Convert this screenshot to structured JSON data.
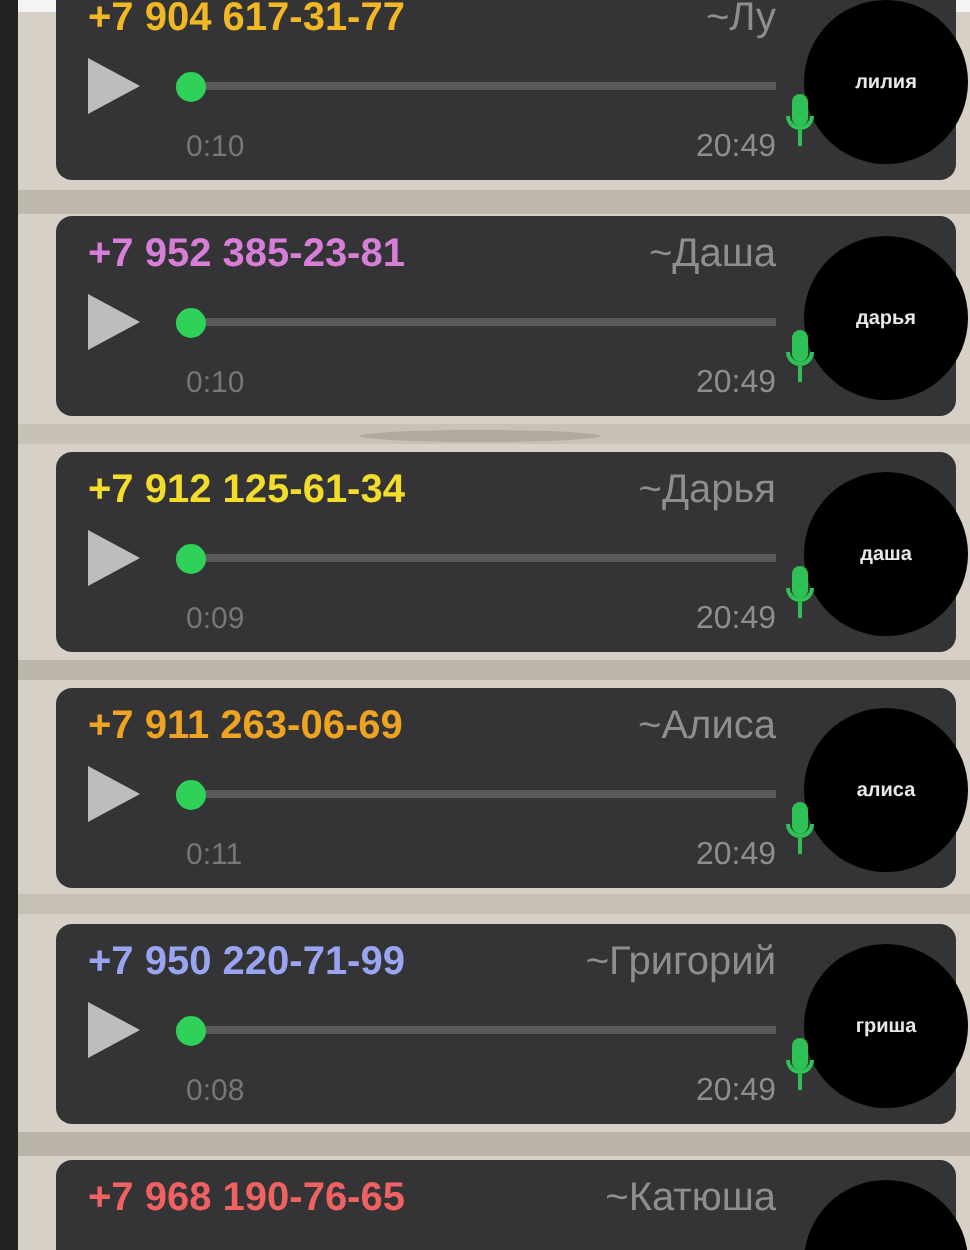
{
  "messages": [
    {
      "phone": "+7 904 617-31-77",
      "color": "#f2b824",
      "name": "~Лу",
      "duration": "0:10",
      "time": "20:49",
      "level": 0,
      "avatar_label": "лилия"
    },
    {
      "phone": "+7 952 385-23-81",
      "color": "#d77ed8",
      "name": "~Даша",
      "duration": "0:10",
      "time": "20:49",
      "level": 0,
      "avatar_label": "дарья"
    },
    {
      "phone": "+7 912 125-61-34",
      "color": "#f3dc2a",
      "name": "~Дарья",
      "duration": "0:09",
      "time": "20:49",
      "level": 0,
      "avatar_label": "даша"
    },
    {
      "phone": "+7 911 263-06-69",
      "color": "#eea321",
      "name": "~Алиса",
      "duration": "0:11",
      "time": "20:49",
      "level": 0,
      "avatar_label": "алиса"
    },
    {
      "phone": "+7 950 220-71-99",
      "color": "#9aa5f2",
      "name": "~Григорий",
      "duration": "0:08",
      "time": "20:49",
      "level": 0,
      "avatar_label": "гриша"
    },
    {
      "phone": "+7 968 190-76-65",
      "color": "#f06262",
      "name": "~Катюша"
    }
  ]
}
